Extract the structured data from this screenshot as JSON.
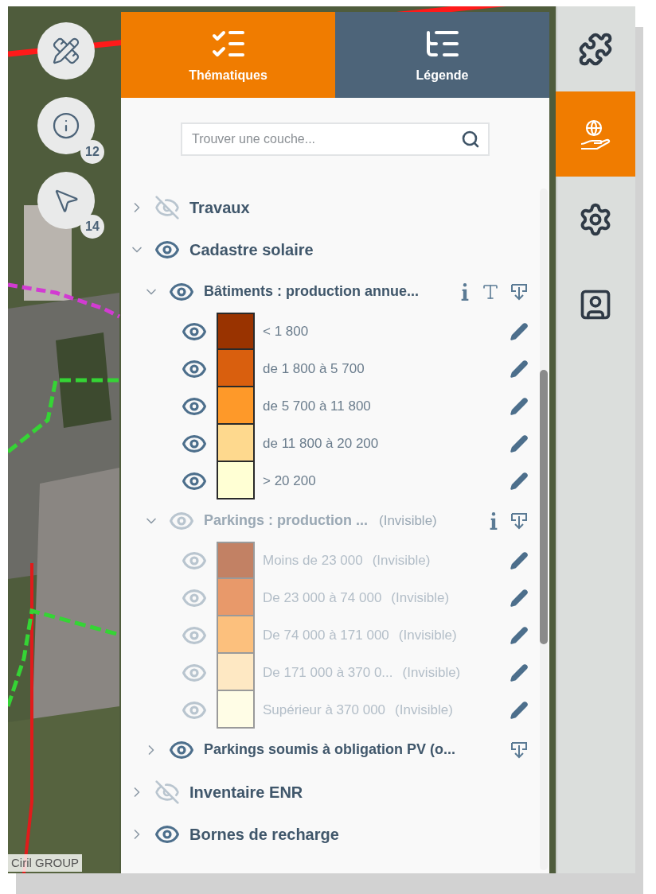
{
  "map_tools": [
    {
      "kind": "draw"
    },
    {
      "kind": "info",
      "badge": "12"
    },
    {
      "kind": "select",
      "badge": "14"
    }
  ],
  "attribution": "Ciril GROUP",
  "tabs": [
    {
      "label": "Thématiques",
      "kind": "themes",
      "selected": true
    },
    {
      "label": "Légende",
      "kind": "legend",
      "selected": false
    }
  ],
  "search": {
    "placeholder": "Trouver une couche..."
  },
  "layers": [
    {
      "name": "Travaux",
      "visible": false,
      "expanded": false
    },
    {
      "name": "Cadastre solaire",
      "visible": true,
      "dimmed": false,
      "expanded": true,
      "children": [
        {
          "name": "Bâtiments : production annue...",
          "visible": true,
          "dimmed": false,
          "expanded": true,
          "info": true,
          "text_style": true,
          "download": true,
          "legend": [
            {
              "label": "< 1 800",
              "color": "#993300",
              "visible": true,
              "dimmed": false
            },
            {
              "label": "de 1 800 à 5 700",
              "color": "#d95f0e",
              "visible": true,
              "dimmed": false
            },
            {
              "label": "de 5 700 à 11 800",
              "color": "#fe9929",
              "visible": true,
              "dimmed": false
            },
            {
              "label": "de 11 800 à 20 200",
              "color": "#fed98e",
              "visible": true,
              "dimmed": false
            },
            {
              "label": "> 20 200",
              "color": "#ffffd4",
              "visible": true,
              "dimmed": false
            }
          ]
        },
        {
          "name": "Parkings : production ...",
          "status": "(Invisible)",
          "visible": true,
          "dimmed": true,
          "expanded": true,
          "info": true,
          "download": true,
          "legend": [
            {
              "label": "Moins de 23 000",
              "status": "(Invisible)",
              "color": "#c28164",
              "visible": true,
              "dimmed": true
            },
            {
              "label": "De 23 000 à 74 000",
              "status": "(Invisible)",
              "color": "#e8996a",
              "visible": true,
              "dimmed": true
            },
            {
              "label": "De 74 000 à 171 000",
              "status": "(Invisible)",
              "color": "#fcc07d",
              "visible": true,
              "dimmed": true
            },
            {
              "label": "De 171 000 à 370 0...",
              "status": "(Invisible)",
              "color": "#fee8c3",
              "visible": true,
              "dimmed": true
            },
            {
              "label": "Supérieur à 370 000",
              "status": "(Invisible)",
              "color": "#fffde6",
              "visible": true,
              "dimmed": true
            }
          ]
        },
        {
          "name": "Parkings soumis à obligation PV (o...",
          "visible": true,
          "dimmed": false,
          "expanded": false,
          "download": true
        }
      ]
    },
    {
      "name": "Inventaire ENR",
      "visible": false,
      "expanded": false
    },
    {
      "name": "Bornes de recharge",
      "visible": true,
      "dimmed": false,
      "expanded": false
    }
  ],
  "toolbar": [
    {
      "kind": "puzzle",
      "selected": false
    },
    {
      "kind": "globe-hand",
      "selected": true
    },
    {
      "kind": "gear-pencil",
      "selected": false
    },
    {
      "kind": "user-upload",
      "selected": false
    }
  ]
}
